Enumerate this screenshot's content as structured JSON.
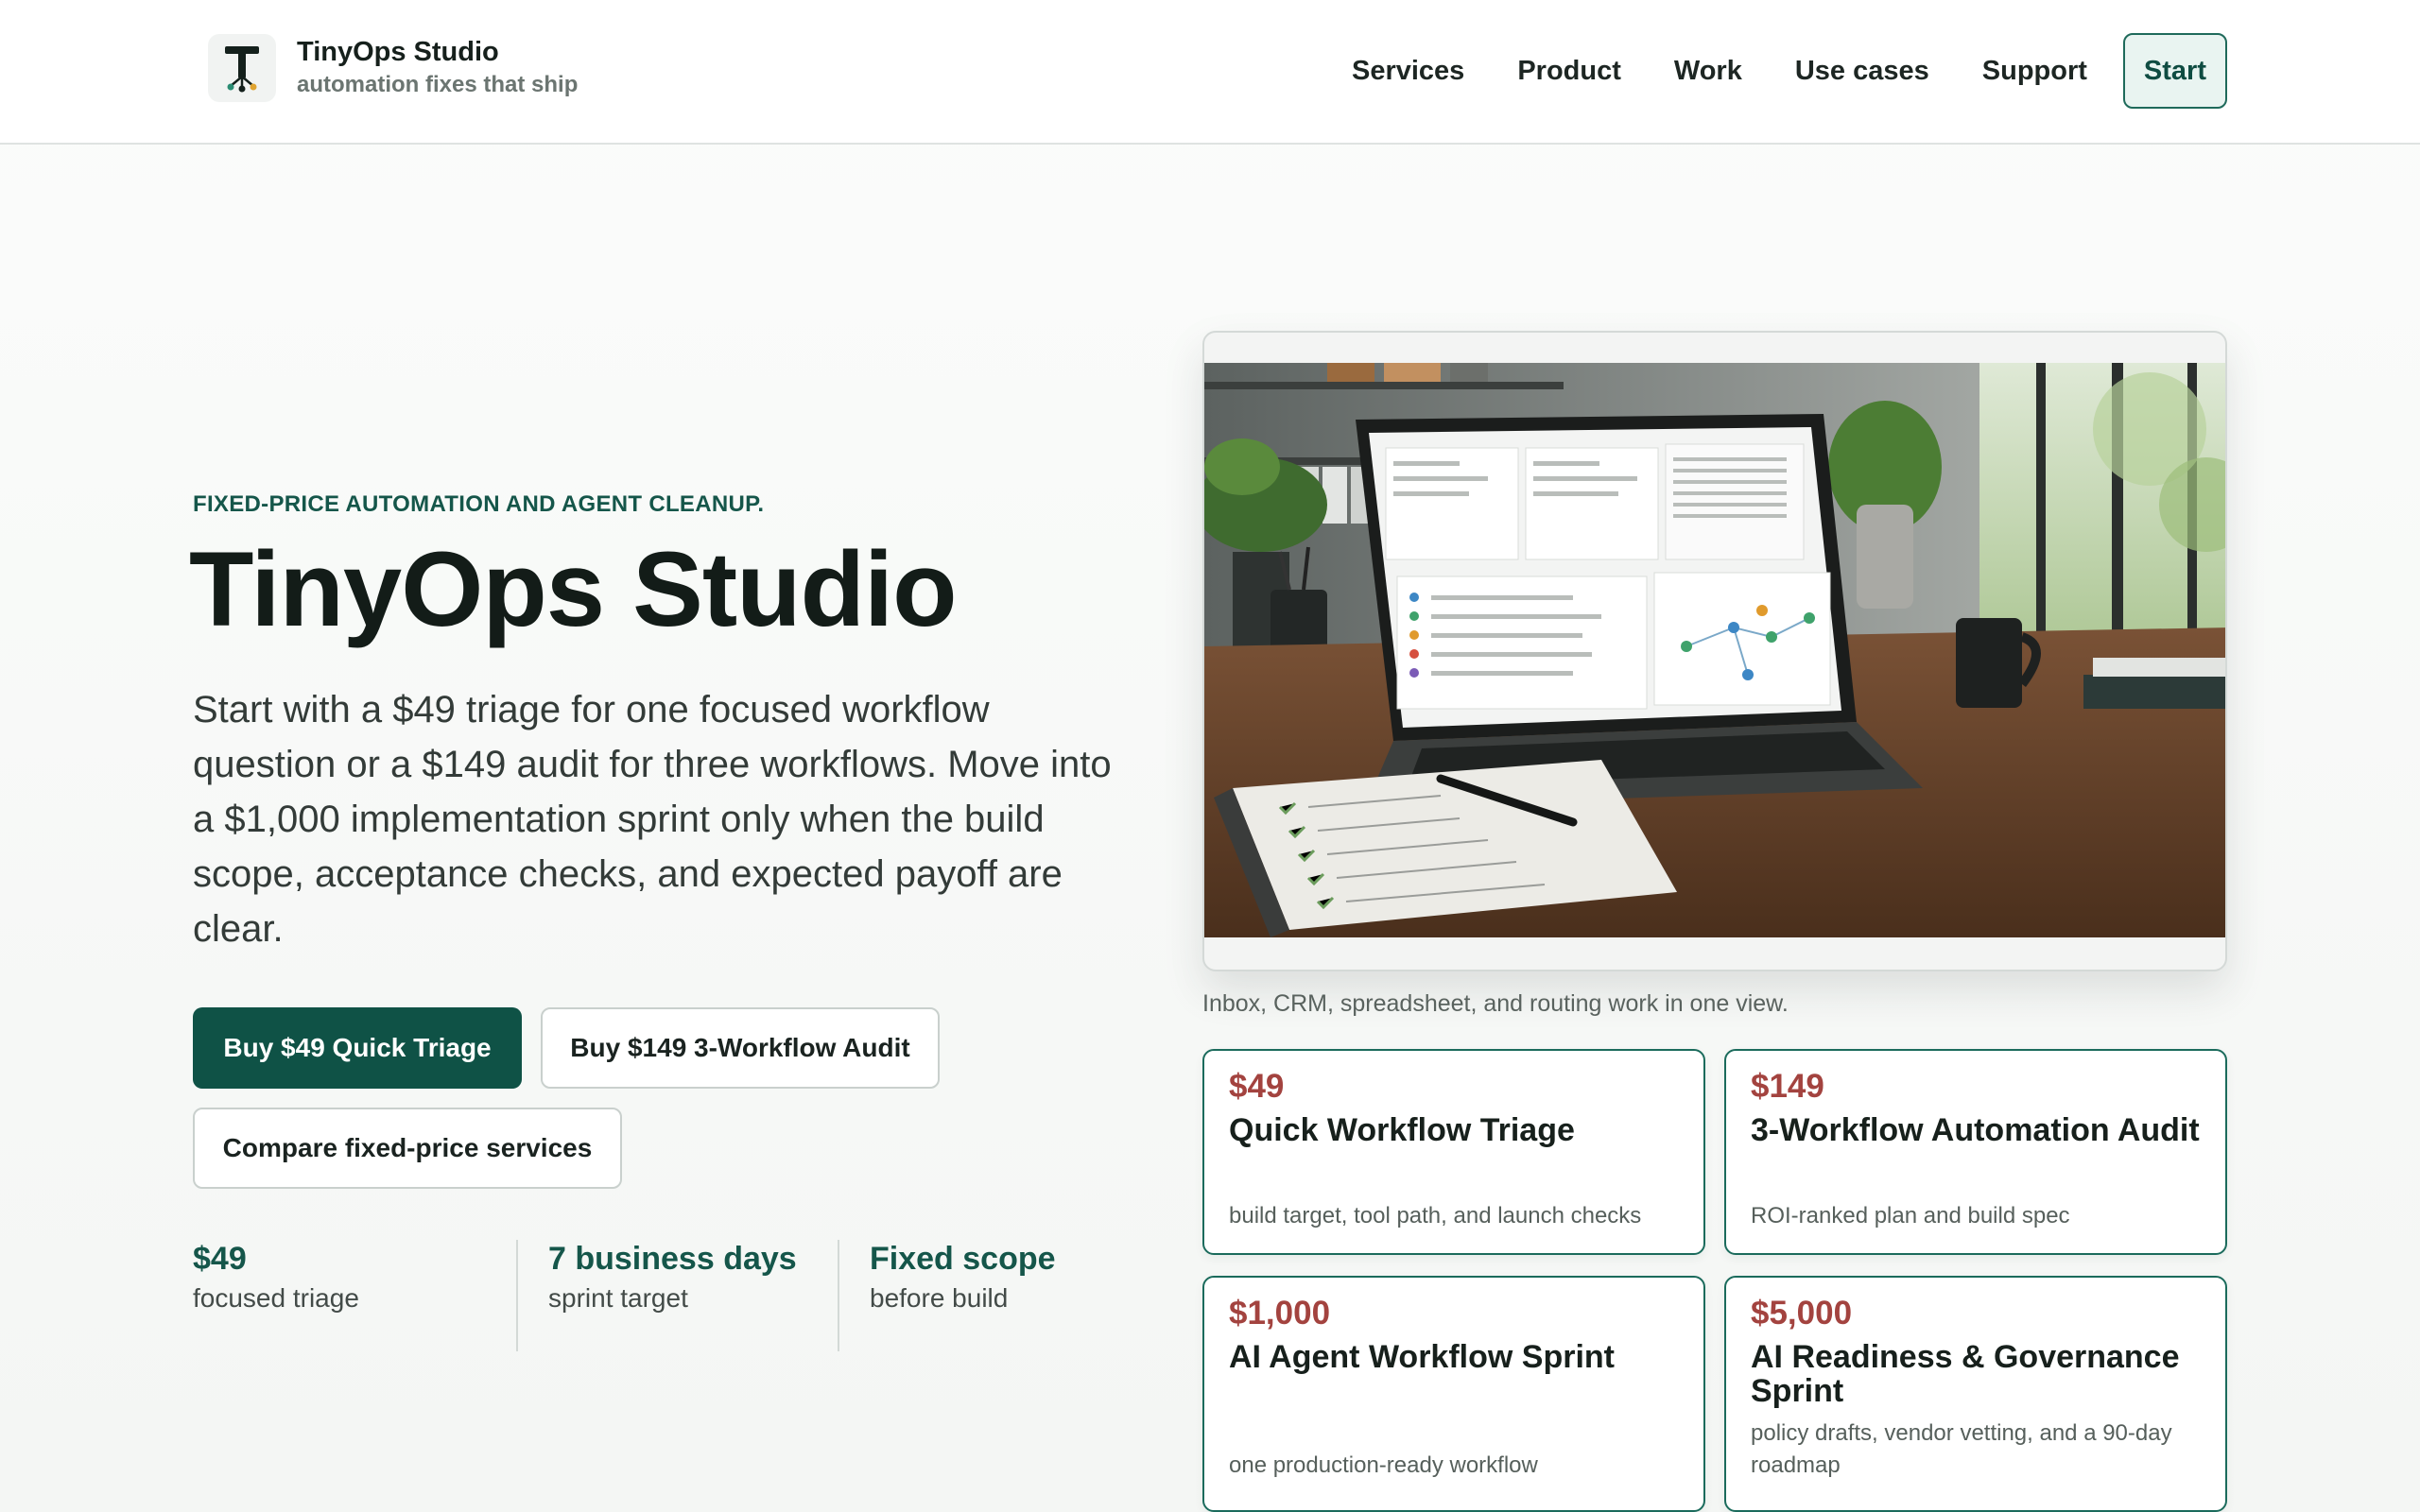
{
  "header": {
    "brand_name": "TinyOps Studio",
    "brand_tagline": "automation fixes that ship",
    "nav": [
      "Services",
      "Product",
      "Work",
      "Use cases",
      "Support"
    ],
    "start_label": "Start"
  },
  "hero": {
    "eyebrow": "FIXED-PRICE AUTOMATION AND AGENT CLEANUP.",
    "title": "TinyOps Studio",
    "description": "Start with a $49 triage for one focused workflow question or a $149 audit for three workflows. Move into a $1,000 implementation sprint only when the build scope, acceptance checks, and expected payoff are clear.",
    "buttons": {
      "triage": "Buy $49 Quick Triage",
      "audit": "Buy $149 3-Workflow Audit",
      "compare": "Compare fixed-price services"
    },
    "stats": [
      {
        "value": "$49",
        "label": "focused triage"
      },
      {
        "value": "7 business days",
        "label": "sprint target"
      },
      {
        "value": "Fixed scope",
        "label": "before build"
      }
    ]
  },
  "media": {
    "caption": "Inbox, CRM, spreadsheet, and routing work in one view."
  },
  "cards": [
    {
      "price": "$49",
      "title": "Quick Workflow Triage",
      "desc": "build target, tool path, and launch checks"
    },
    {
      "price": "$149",
      "title": "3-Workflow Automation Audit",
      "desc": "ROI-ranked plan and build spec"
    },
    {
      "price": "$1,000",
      "title": "AI Agent Workflow Sprint",
      "desc": "one production-ready workflow"
    },
    {
      "price": "$5,000",
      "title": "AI Readiness & Governance Sprint",
      "desc": "policy drafts, vendor vetting, and a 90-day roadmap"
    }
  ],
  "colors": {
    "accent": "#0f5246",
    "price": "#a3433f",
    "card_border": "#1b6b5c"
  }
}
